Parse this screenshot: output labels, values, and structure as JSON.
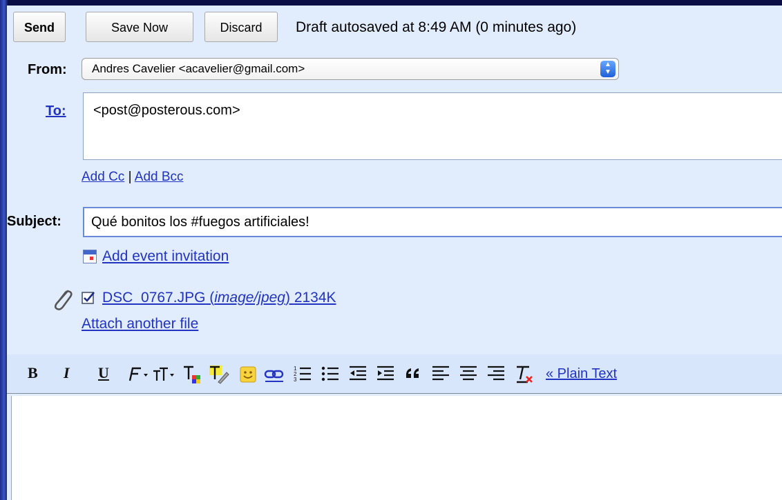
{
  "buttons": {
    "send": "Send",
    "save_now": "Save Now",
    "discard": "Discard"
  },
  "status": "Draft autosaved at 8:49 AM (0 minutes ago)",
  "from": {
    "label": "From:",
    "value": "Andres Cavelier <acavelier@gmail.com>"
  },
  "to": {
    "label": "To:",
    "value": "<post@posterous.com>"
  },
  "cc_links": {
    "add_cc": "Add Cc",
    "separator": "|",
    "add_bcc": "Add Bcc"
  },
  "subject": {
    "label": "Subject:",
    "value": "Qué bonitos los #fuegos artificiales!"
  },
  "event_link": "Add event invitation",
  "attachment": {
    "name": "DSC_0767.JPG",
    "type": "image/jpeg",
    "size": "2134K",
    "attach_another": "Attach another file"
  },
  "toolbar": {
    "bold": "B",
    "italic": "I",
    "underline": "U",
    "plain_text": "« Plain Text"
  },
  "icons": {
    "attachment": "paperclip-icon",
    "event": "calendar-icon",
    "checkbox": "checkbox-checked-icon",
    "font": "font-icon",
    "font_size": "font-size-icon",
    "text_color": "text-color-icon",
    "highlight": "highlight-icon",
    "emoticon": "emoticon-icon",
    "link": "link-icon",
    "numbered_list": "numbered-list-icon",
    "bullet_list": "bullet-list-icon",
    "indent_less": "indent-less-icon",
    "indent_more": "indent-more-icon",
    "quote": "quote-icon",
    "align_left": "align-left-icon",
    "align_center": "align-center-icon",
    "align_right": "align-right-icon",
    "remove_formatting": "remove-formatting-icon"
  },
  "colors": {
    "panel_bg": "#e1ecfd",
    "link": "#2133c0",
    "frame_bg": "#0a0c3e"
  }
}
